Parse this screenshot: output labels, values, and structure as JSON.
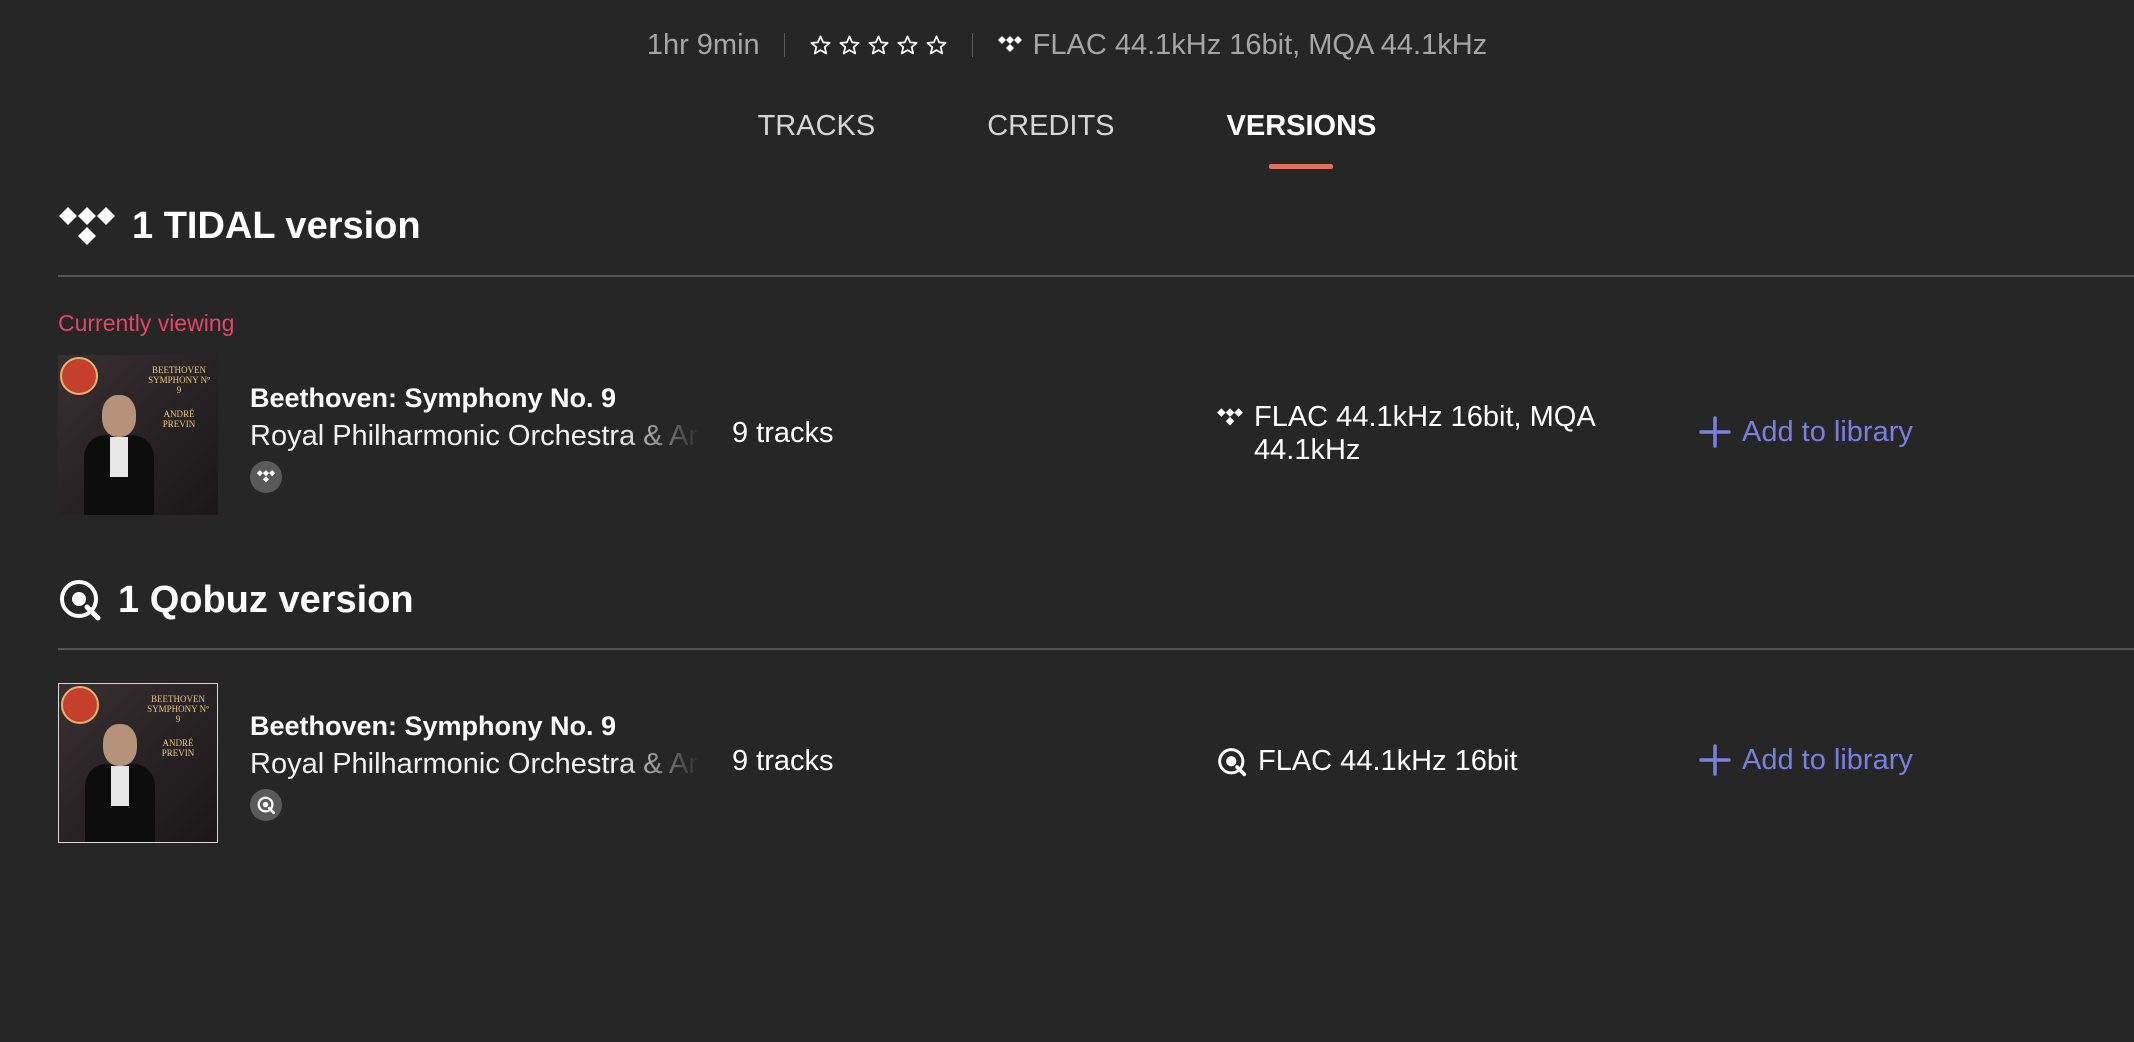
{
  "meta": {
    "duration": "1hr 9min",
    "rating": 0,
    "rating_max": 5,
    "quality": "FLAC 44.1kHz 16bit, MQA 44.1kHz"
  },
  "tabs": [
    {
      "label": "TRACKS",
      "active": false
    },
    {
      "label": "CREDITS",
      "active": false
    },
    {
      "label": "VERSIONS",
      "active": true
    }
  ],
  "tidal_section": {
    "heading": "1 TIDAL version",
    "currently_viewing": "Currently viewing",
    "items": [
      {
        "title": "Beethoven: Symphony No. 9",
        "artist": "Royal Philharmonic Orchestra & Andr",
        "tracks": "9 tracks",
        "quality_line1": "FLAC 44.1kHz 16bit, MQA",
        "quality_line2": "44.1kHz",
        "add_label": "Add to library",
        "cover_text": [
          "BEETHOVEN",
          "SYMPHONY Nº 9",
          "ANDRÉ PREVIN"
        ]
      }
    ]
  },
  "qobuz_section": {
    "heading": "1 Qobuz version",
    "items": [
      {
        "title": "Beethoven: Symphony No. 9",
        "artist": "Royal Philharmonic Orchestra & Andr",
        "tracks": "9 tracks",
        "quality": "FLAC 44.1kHz 16bit",
        "add_label": "Add to library",
        "cover_text": [
          "BEETHOVEN",
          "SYMPHONY Nº 9",
          "ANDRÉ PREVIN"
        ]
      }
    ]
  },
  "colors": {
    "background": "#262626",
    "accent_add": "#7a80e0",
    "currently_viewing": "#e0476a",
    "tab_indicator": "#e0705f"
  },
  "icons": [
    "tidal-icon",
    "qobuz-icon",
    "star-outline-icon",
    "plus-icon"
  ]
}
